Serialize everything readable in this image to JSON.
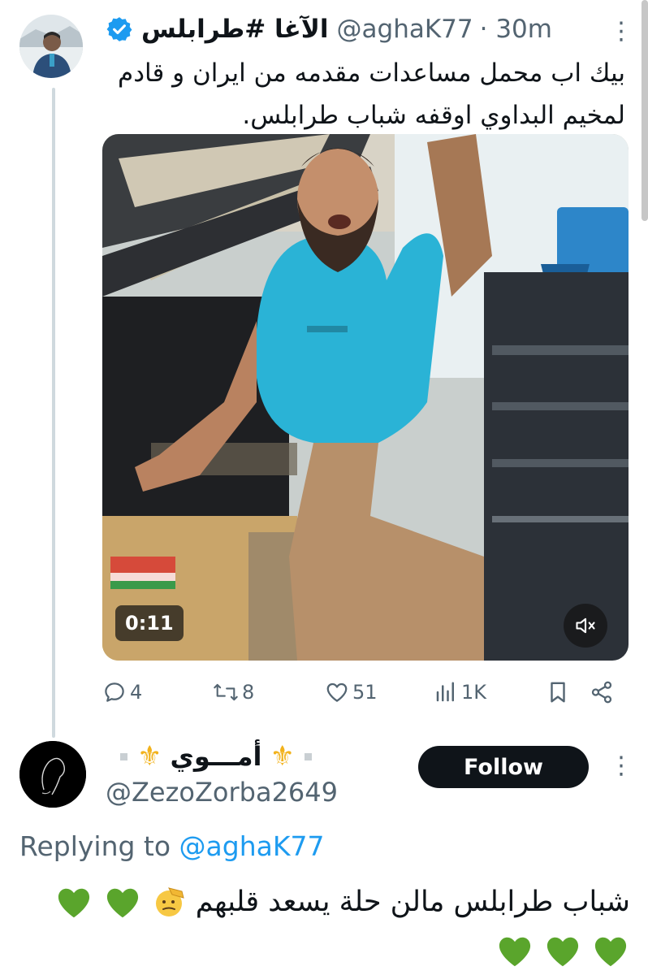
{
  "tweet": {
    "display_name": "الآغا #طرابلس",
    "handle": "@aghaK77",
    "time": "· 30m",
    "text": "بيك اب محمل مساعدات مقدمه من ايران و قادم لمخيم البداوي اوقفه شباب طرابلس.",
    "verified": true
  },
  "media": {
    "duration": "0:11",
    "muted": true
  },
  "actions": {
    "replies": "4",
    "retweets": "8",
    "likes": "51",
    "views": "1K"
  },
  "reply": {
    "display_name": "أمـــوي",
    "handle": "@ZezoZorba2649",
    "follow_label": "Follow",
    "replying_prefix": "Replying to",
    "replying_to": "@aghaK77",
    "text": "شباب طرابلس مالن حلة يسعد قلبهم"
  },
  "colors": {
    "accent": "#1d9bf0",
    "muted_text": "#536471",
    "follow_bg": "#0f1419",
    "heart_emoji": "#5aa52c",
    "fleur": "#f2b21b"
  },
  "icons": [
    "verified-badge-icon",
    "more-icon",
    "reply-icon",
    "retweet-icon",
    "like-icon",
    "views-icon",
    "bookmark-icon",
    "share-icon",
    "mute-icon",
    "fleur-de-lis-icon",
    "saluting-face-emoji",
    "green-heart-emoji"
  ]
}
